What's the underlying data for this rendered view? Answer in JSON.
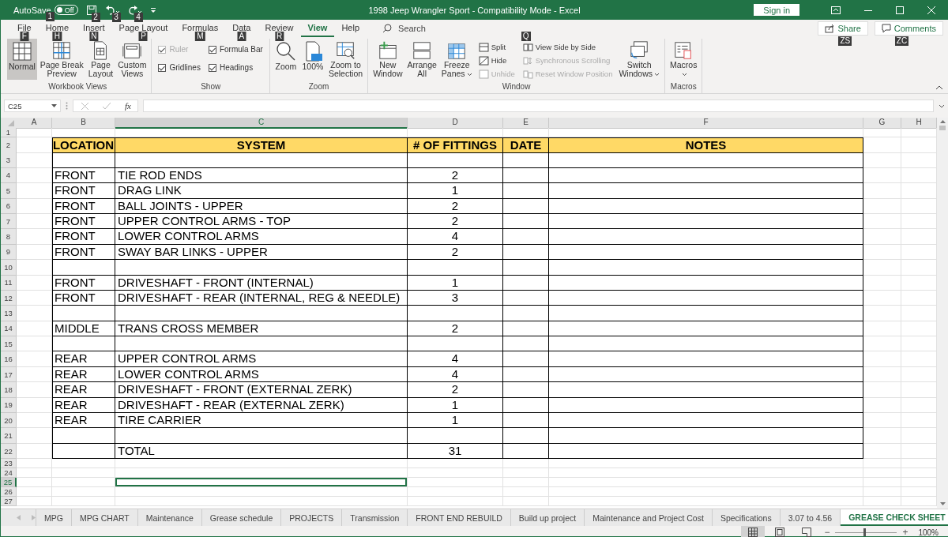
{
  "title_bar": {
    "autosave_label": "AutoSave",
    "autosave_state": "Off",
    "autosave_on": false,
    "key_tips": [
      "1",
      "2",
      "3",
      "4"
    ],
    "title": "1998 Jeep Wrangler Sport  -  Compatibility Mode  -  Excel",
    "sign_in": "Sign in"
  },
  "ribbon_tabs": [
    {
      "label": "File",
      "key_tip": "F",
      "selected": false
    },
    {
      "label": "Home",
      "key_tip": "H",
      "selected": false
    },
    {
      "label": "Insert",
      "key_tip": "N",
      "selected": false
    },
    {
      "label": "Page Layout",
      "key_tip": "P",
      "selected": false
    },
    {
      "label": "Formulas",
      "key_tip": "M",
      "selected": false
    },
    {
      "label": "Data",
      "key_tip": "A",
      "selected": false
    },
    {
      "label": "Review",
      "key_tip": "R",
      "selected": false
    },
    {
      "label": "View",
      "selected": true
    },
    {
      "label": "Help",
      "selected": false
    }
  ],
  "search": {
    "label": "Search"
  },
  "share": {
    "label": "Share",
    "key_tip": "ZS"
  },
  "comments": {
    "label": "Comments",
    "key_tip": "ZC"
  },
  "ribbon_groups": [
    {
      "name": "Workbook Views",
      "items": [
        {
          "kind": "large",
          "lines": [
            "Normal"
          ],
          "selected": true
        },
        {
          "kind": "large",
          "lines": [
            "Page Break",
            "Preview"
          ],
          "selected": false
        },
        {
          "kind": "large",
          "lines": [
            "Page",
            "Layout"
          ],
          "selected": false
        },
        {
          "kind": "large",
          "lines": [
            "Custom",
            "Views"
          ],
          "selected": false
        }
      ]
    },
    {
      "name": "Show",
      "items": [
        {
          "kind": "stack",
          "items": [
            {
              "kind": "check",
              "label": "Ruler",
              "checked": true,
              "disabled": true
            },
            {
              "kind": "check",
              "label": "Gridlines",
              "checked": true,
              "disabled": false
            }
          ]
        },
        {
          "kind": "stack",
          "items": [
            {
              "kind": "check",
              "label": "Formula Bar",
              "checked": true,
              "disabled": false
            },
            {
              "kind": "check",
              "label": "Headings",
              "checked": true,
              "disabled": false
            }
          ]
        }
      ]
    },
    {
      "name": "Zoom",
      "items": [
        {
          "kind": "large",
          "lines": [
            "Zoom"
          ],
          "selected": false
        },
        {
          "kind": "large",
          "lines": [
            "100%"
          ],
          "selected": false
        },
        {
          "kind": "large",
          "lines": [
            "Zoom to",
            "Selection"
          ],
          "selected": false
        }
      ]
    },
    {
      "name": "Window",
      "items": [
        {
          "kind": "large",
          "lines": [
            "New",
            "Window"
          ],
          "selected": false
        },
        {
          "kind": "large",
          "lines": [
            "Arrange",
            "All"
          ],
          "selected": false
        },
        {
          "kind": "large",
          "lines": [
            "Freeze",
            "Panes"
          ],
          "dropdown": true,
          "selected": false
        },
        {
          "kind": "stack",
          "items": [
            {
              "kind": "small",
              "label": "Split",
              "disabled": false
            },
            {
              "kind": "small",
              "label": "Hide",
              "disabled": false
            },
            {
              "kind": "small",
              "label": "Unhide",
              "disabled": true
            }
          ]
        },
        {
          "kind": "stack",
          "key_tip": "Q",
          "items": [
            {
              "kind": "small",
              "label": "View Side by Side",
              "disabled": false
            },
            {
              "kind": "small",
              "label": "Synchronous Scrolling",
              "disabled": true
            },
            {
              "kind": "small",
              "label": "Reset Window Position",
              "disabled": true
            }
          ]
        },
        {
          "kind": "large",
          "lines": [
            "Switch",
            "Windows"
          ],
          "dropdown": true,
          "selected": false
        }
      ]
    },
    {
      "name": "Macros",
      "items": [
        {
          "kind": "large",
          "lines": [
            "Macros"
          ],
          "dropdown": true,
          "selected": false
        }
      ]
    }
  ],
  "formula_bar": {
    "name_box": "C25",
    "function_label": "fx"
  },
  "columns": [
    {
      "label": "A",
      "selected": false
    },
    {
      "label": "B",
      "selected": false
    },
    {
      "label": "C",
      "selected": true
    },
    {
      "label": "D",
      "selected": false
    },
    {
      "label": "E",
      "selected": false
    },
    {
      "label": "F",
      "selected": false
    },
    {
      "label": "G",
      "selected": false
    },
    {
      "label": "H",
      "selected": false
    }
  ],
  "rows": [
    {
      "number": "1",
      "kind": "plain",
      "selected": false
    },
    {
      "number": "2",
      "kind": "header",
      "selected": false,
      "location": "LOCATION",
      "system": "SYSTEM",
      "fittings": "# OF FITTINGS",
      "date": "DATE",
      "notes": "NOTES"
    },
    {
      "number": "3",
      "kind": "table",
      "selected": false
    },
    {
      "number": "4",
      "kind": "table",
      "selected": false,
      "location": "FRONT",
      "system": "TIE ROD ENDS",
      "fittings": "2"
    },
    {
      "number": "5",
      "kind": "table",
      "selected": false,
      "location": "FRONT",
      "system": "DRAG LINK",
      "fittings": "1"
    },
    {
      "number": "6",
      "kind": "table",
      "selected": false,
      "location": "FRONT",
      "system": "BALL JOINTS - UPPER",
      "fittings": "2"
    },
    {
      "number": "7",
      "kind": "table",
      "selected": false,
      "location": "FRONT",
      "system": "UPPER CONTROL ARMS - TOP",
      "fittings": "2"
    },
    {
      "number": "8",
      "kind": "table",
      "selected": false,
      "location": "FRONT",
      "system": "LOWER CONTROL ARMS",
      "fittings": "4"
    },
    {
      "number": "9",
      "kind": "table",
      "selected": false,
      "location": "FRONT",
      "system": "SWAY BAR LINKS - UPPER",
      "fittings": "2"
    },
    {
      "number": "10",
      "kind": "table",
      "selected": false
    },
    {
      "number": "11",
      "kind": "table",
      "selected": false,
      "location": "FRONT",
      "system": "DRIVESHAFT - FRONT  (INTERNAL)",
      "fittings": "1"
    },
    {
      "number": "12",
      "kind": "table",
      "selected": false,
      "location": "FRONT",
      "system": "DRIVESHAFT - REAR  (INTERNAL, REG & NEEDLE)",
      "fittings": "3"
    },
    {
      "number": "13",
      "kind": "table",
      "selected": false
    },
    {
      "number": "14",
      "kind": "table",
      "selected": false,
      "location": "MIDDLE",
      "system": "TRANS CROSS MEMBER",
      "fittings": "2"
    },
    {
      "number": "15",
      "kind": "table",
      "selected": false
    },
    {
      "number": "16",
      "kind": "table",
      "selected": false,
      "location": "REAR",
      "system": "UPPER CONTROL ARMS",
      "fittings": "4"
    },
    {
      "number": "17",
      "kind": "table",
      "selected": false,
      "location": "REAR",
      "system": "LOWER CONTROL ARMS",
      "fittings": "4"
    },
    {
      "number": "18",
      "kind": "table",
      "selected": false,
      "location": "REAR",
      "system": "DRIVESHAFT - FRONT  (EXTERNAL ZERK)",
      "fittings": "2"
    },
    {
      "number": "19",
      "kind": "table",
      "selected": false,
      "location": "REAR",
      "system": "DRIVESHAFT - REAR  (EXTERNAL ZERK)",
      "fittings": "1"
    },
    {
      "number": "20",
      "kind": "table",
      "selected": false,
      "location": "REAR",
      "system": "TIRE CARRIER",
      "fittings": "1"
    },
    {
      "number": "21",
      "kind": "table",
      "selected": false
    },
    {
      "number": "22",
      "kind": "table",
      "selected": false,
      "system": "TOTAL",
      "fittings": "31"
    },
    {
      "number": "23",
      "kind": "plain",
      "selected": false
    },
    {
      "number": "24",
      "kind": "plain",
      "selected": false
    },
    {
      "number": "25",
      "kind": "plain",
      "selected": true
    },
    {
      "number": "26",
      "kind": "plain",
      "selected": false
    },
    {
      "number": "27",
      "kind": "plain",
      "selected": false
    }
  ],
  "sheet_tabs": [
    {
      "label": "MPG",
      "selected": false
    },
    {
      "label": "MPG CHART",
      "selected": false
    },
    {
      "label": "Maintenance",
      "selected": false
    },
    {
      "label": "Grease schedule",
      "selected": false
    },
    {
      "label": "PROJECTS",
      "selected": false
    },
    {
      "label": "Transmission",
      "selected": false
    },
    {
      "label": "FRONT END REBUILD",
      "selected": false
    },
    {
      "label": "Build up project",
      "selected": false
    },
    {
      "label": "Maintenance and Project Cost",
      "selected": false
    },
    {
      "label": "Specifications",
      "selected": false
    },
    {
      "label": "3.07 to 4.56",
      "selected": false
    },
    {
      "label": "GREASE CHECK SHEET",
      "selected": true
    }
  ],
  "status_bar": {
    "views": [
      {
        "selected": true
      },
      {
        "selected": false
      },
      {
        "selected": false
      }
    ],
    "zoom_out": "−",
    "zoom_in": "+",
    "zoom": {
      "level": 0.47
    },
    "zoom_label": "100%"
  }
}
